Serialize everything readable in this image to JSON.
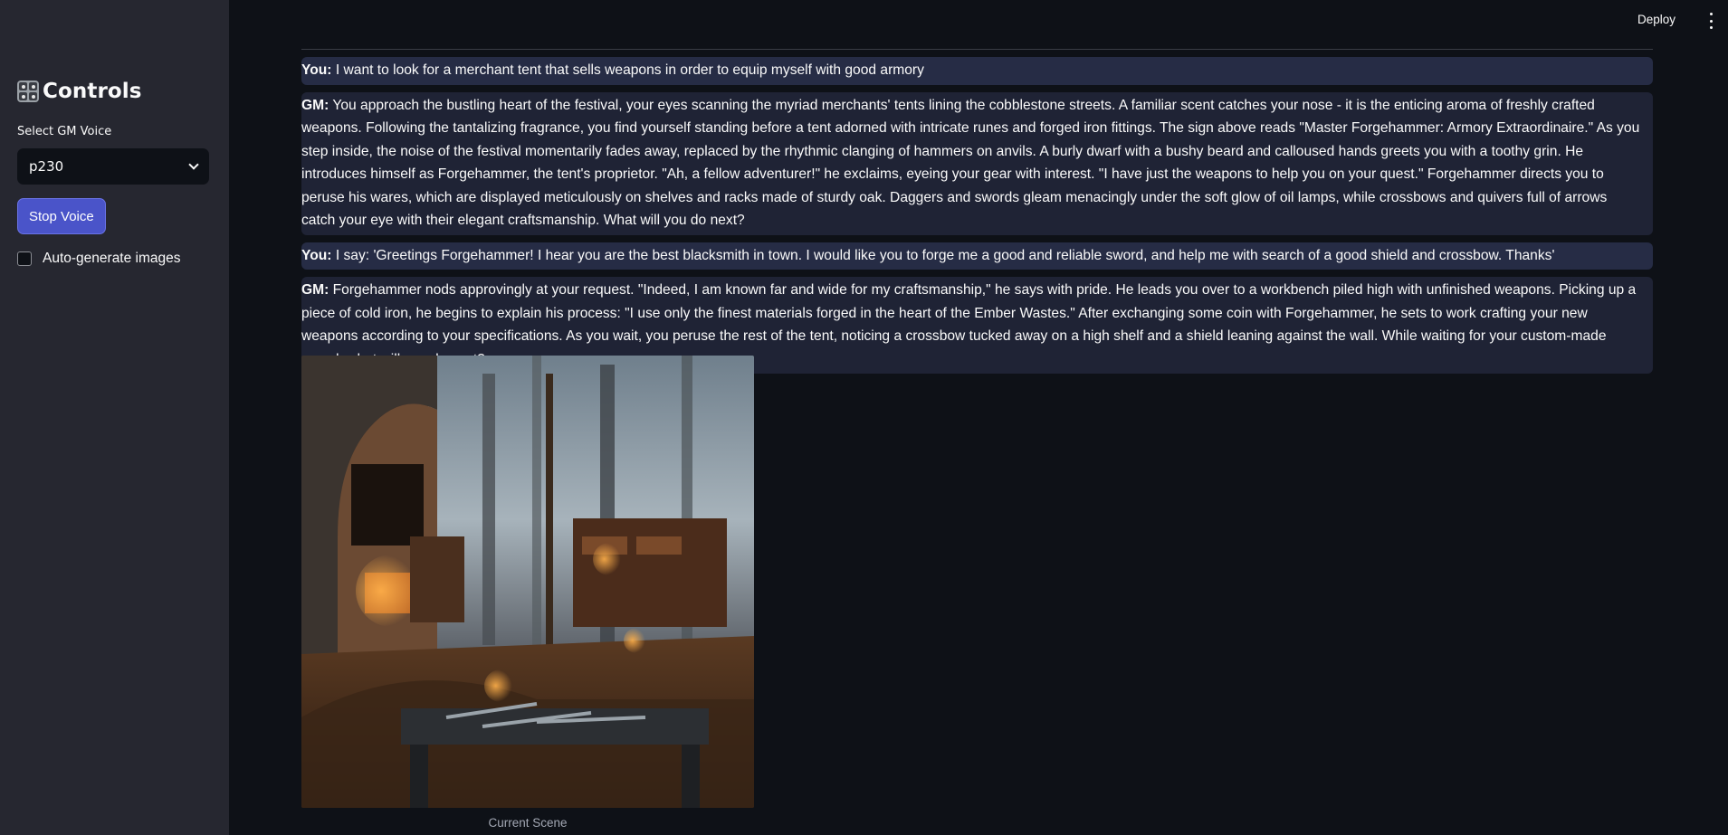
{
  "sidebar": {
    "title": "Controls",
    "voice_label": "Select GM Voice",
    "voice_value": "p230",
    "stop_button": "Stop Voice",
    "auto_images_label": "Auto-generate images"
  },
  "topbar": {
    "deploy_label": "Deploy"
  },
  "chat": [
    {
      "speaker": "You:",
      "text": "I want to look for a merchant tent that sells weapons in order to equip myself with good armory"
    },
    {
      "speaker": "GM:",
      "text": "You approach the bustling heart of the festival, your eyes scanning the myriad merchants' tents lining the cobblestone streets. A familiar scent catches your nose - it is the enticing aroma of freshly crafted weapons. Following the tantalizing fragrance, you find yourself standing before a tent adorned with intricate runes and forged iron fittings. The sign above reads \"Master Forgehammer: Armory Extraordinaire.\" As you step inside, the noise of the festival momentarily fades away, replaced by the rhythmic clanging of hammers on anvils. A burly dwarf with a bushy beard and calloused hands greets you with a toothy grin. He introduces himself as Forgehammer, the tent's proprietor. \"Ah, a fellow adventurer!\" he exclaims, eyeing your gear with interest. \"I have just the weapons to help you on your quest.\" Forgehammer directs you to peruse his wares, which are displayed meticulously on shelves and racks made of sturdy oak. Daggers and swords gleam menacingly under the soft glow of oil lamps, while crossbows and quivers full of arrows catch your eye with their elegant craftsmanship. What will you do next?"
    },
    {
      "speaker": "You:",
      "text": "I say: 'Greetings Forgehammer! I hear you are the best blacksmith in town. I would like you to forge me a good and reliable sword, and help me with search of a good shield and crossbow. Thanks'"
    },
    {
      "speaker": "GM:",
      "text": "Forgehammer nods approvingly at your request. \"Indeed, I am known far and wide for my craftsmanship,\" he says with pride. He leads you over to a workbench piled high with unfinished weapons. Picking up a piece of cold iron, he begins to explain his process: \"I use only the finest materials forged in the heart of the Ember Wastes.\" After exchanging some coin with Forgehammer, he sets to work crafting your new weapons according to your specifications. As you wait, you peruse the rest of the tent, noticing a crossbow tucked away on a high shelf and a shield leaning against the wall. While waiting for your custom-made sword, what will you do next?"
    }
  ],
  "scene": {
    "caption": "Current Scene"
  }
}
